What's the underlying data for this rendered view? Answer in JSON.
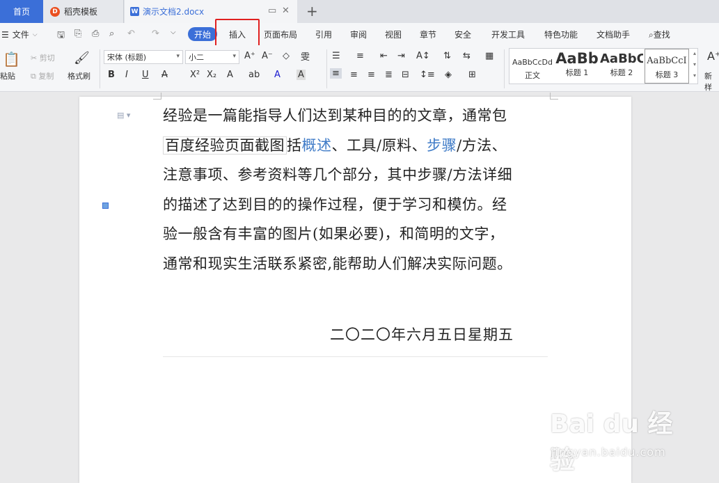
{
  "tabs": {
    "home": "首页",
    "template": "稻壳模板",
    "document": "演示文档2.docx"
  },
  "menu": {
    "file": "文件",
    "items": [
      "开始",
      "插入",
      "页面布局",
      "引用",
      "审阅",
      "视图",
      "章节",
      "安全",
      "开发工具",
      "特色功能",
      "文档助手",
      "查找"
    ]
  },
  "ribbon": {
    "paste": "粘贴",
    "cut": "剪切",
    "copy": "复制",
    "format_painter": "格式刷",
    "font_name": "宋体 (标题)",
    "font_size": "小二",
    "styles": [
      {
        "preview": "AaBbCcDd",
        "label": "正文"
      },
      {
        "preview": "AaBb",
        "label": "标题 1"
      },
      {
        "preview": "AaBbC",
        "label": "标题 2"
      },
      {
        "preview": "AaBbCcI",
        "label": "标题 3"
      }
    ],
    "new_style": "新样"
  },
  "document": {
    "line1": "经验是一篇能指导人们达到某种目的的文章，通常包",
    "boxed": "百度经验页面截图",
    "line2_a": "括",
    "link1": "概述",
    "line2_b": "、工具/原料、",
    "link2": "步骤",
    "line2_c": "/方法、",
    "line3": "注意事项、参考资料等几个部分，其中步骤/方法详细",
    "line4": "的描述了达到目的的操作过程，便于学习和模仿。经",
    "line5": "验一般含有丰富的图片(如果必要)，和简明的文字，",
    "line6": "通常和现实生活联系紧密,能帮助人们解决实际问题。",
    "date": "二〇二〇年六月五日星期五"
  },
  "watermark": {
    "brand": "Bai du 经验",
    "url": "jingyan.baidu.com"
  },
  "colors": {
    "accent": "#3b6fd8",
    "highlight": "#e02020",
    "link": "#3f7bc7"
  }
}
